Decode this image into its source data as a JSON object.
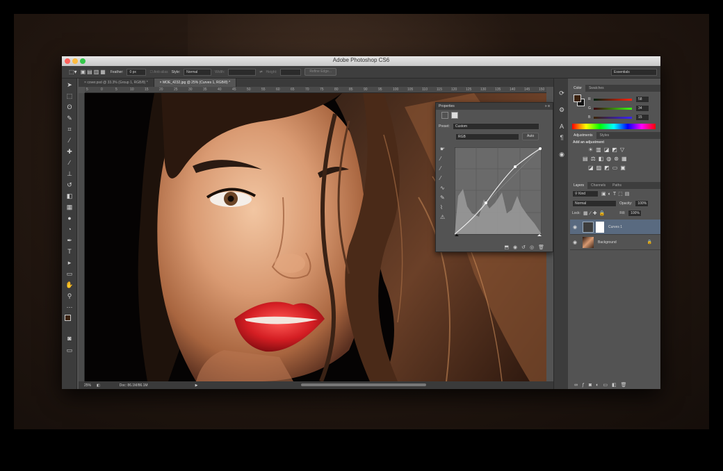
{
  "window": {
    "title": "Adobe Photoshop CS6"
  },
  "options_bar": {
    "feather_label": "Feather:",
    "feather_value": "0 px",
    "antialias_label": "Anti-alias",
    "style_label": "Style:",
    "style_value": "Normal",
    "width_label": "Width:",
    "height_label": "Height:",
    "refine_edge": "Refine Edge...",
    "workspace": "Essentials"
  },
  "doc_tabs": [
    {
      "label": "cover.psd @ 33.3% (Group 1, RGB/8) *"
    },
    {
      "label": "MOE_4232.jpg @ 25% (Curves 1, RGB/8) *"
    }
  ],
  "ruler_ticks": [
    "5",
    "0",
    "5",
    "10",
    "15",
    "20",
    "25",
    "30",
    "35",
    "40",
    "45",
    "50",
    "55",
    "60",
    "65",
    "70",
    "75",
    "80",
    "85",
    "90",
    "95",
    "100",
    "105",
    "110",
    "115",
    "120",
    "125",
    "130",
    "135",
    "140",
    "145",
    "150"
  ],
  "status": {
    "zoom": "25%",
    "doc": "Doc: 86.1M/86.1M"
  },
  "properties": {
    "panel_title": "Properties",
    "preset_label": "Preset:",
    "preset_value": "Custom",
    "channel_value": "RGB",
    "auto_button": "Auto"
  },
  "color_panel": {
    "tabs": [
      "Color",
      "Swatches"
    ],
    "r_label": "R",
    "r_value": "58",
    "g_label": "G",
    "g_value": "34",
    "b_label": "B",
    "b_value": "15",
    "fg_color": "#3a220f",
    "bg_color": "#111111"
  },
  "adjustments": {
    "tabs": [
      "Adjustments",
      "Styles"
    ],
    "heading": "Add an adjustment"
  },
  "layers_panel": {
    "tabs": [
      "Layers",
      "Channels",
      "Paths"
    ],
    "kind_label": "Kind",
    "blend_mode": "Normal",
    "opacity_label": "Opacity:",
    "opacity_value": "100%",
    "lock_label": "Lock:",
    "fill_label": "Fill:",
    "fill_value": "100%",
    "layers": [
      {
        "name": "Curves 1"
      },
      {
        "name": "Background"
      }
    ]
  },
  "icons": {
    "close": "close-icon",
    "minimize": "minimize-icon",
    "maximize": "maximize-icon"
  }
}
